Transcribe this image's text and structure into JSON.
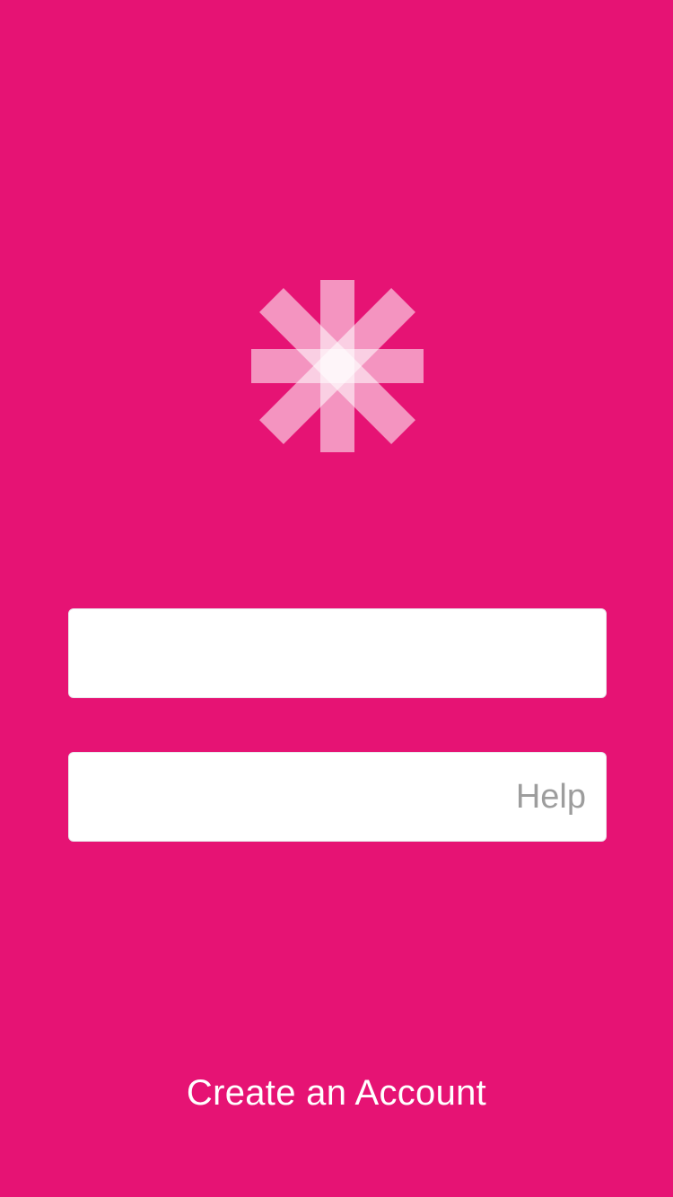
{
  "app": {
    "logo_icon": "asterisk-icon",
    "background_color": "#e61374"
  },
  "form": {
    "field_1": {
      "value": "",
      "placeholder": ""
    },
    "field_2": {
      "value": "",
      "placeholder": "",
      "help_label": "Help"
    }
  },
  "footer": {
    "create_account_label": "Create an Account"
  }
}
